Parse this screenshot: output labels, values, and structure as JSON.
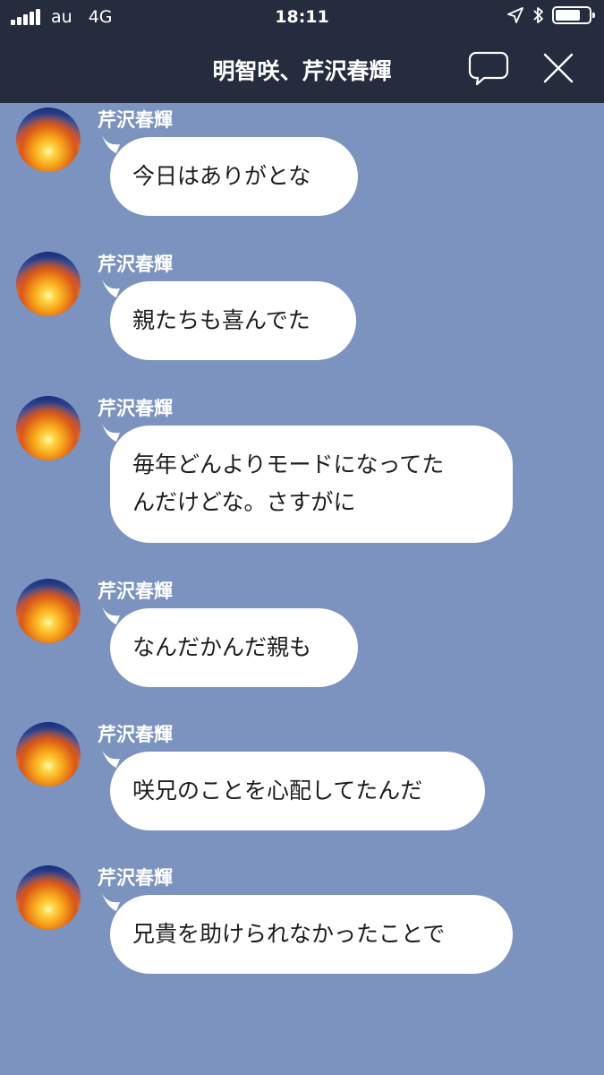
{
  "status_bar": {
    "carrier": "au",
    "network": "4G",
    "time": "18:11",
    "battery_level": 0.75
  },
  "header": {
    "title": "明智咲、芹沢春輝"
  },
  "messages": [
    {
      "sender": "芹沢春輝",
      "lines": [
        "今日はありがとな"
      ]
    },
    {
      "sender": "芹沢春輝",
      "lines": [
        "親たちも喜んでた"
      ]
    },
    {
      "sender": "芹沢春輝",
      "lines": [
        "毎年どんよりモードになってた",
        "んだけどな。さすがに"
      ]
    },
    {
      "sender": "芹沢春輝",
      "lines": [
        "なんだかんだ親も"
      ]
    },
    {
      "sender": "芹沢春輝",
      "lines": [
        "咲兄のことを心配してたんだ"
      ]
    },
    {
      "sender": "芹沢春輝",
      "lines": [
        "兄貴を助けられなかったことで"
      ]
    }
  ],
  "colors": {
    "header_bg": "#252c3d",
    "chat_bg": "#7b93be",
    "bubble_bg": "#ffffff"
  }
}
